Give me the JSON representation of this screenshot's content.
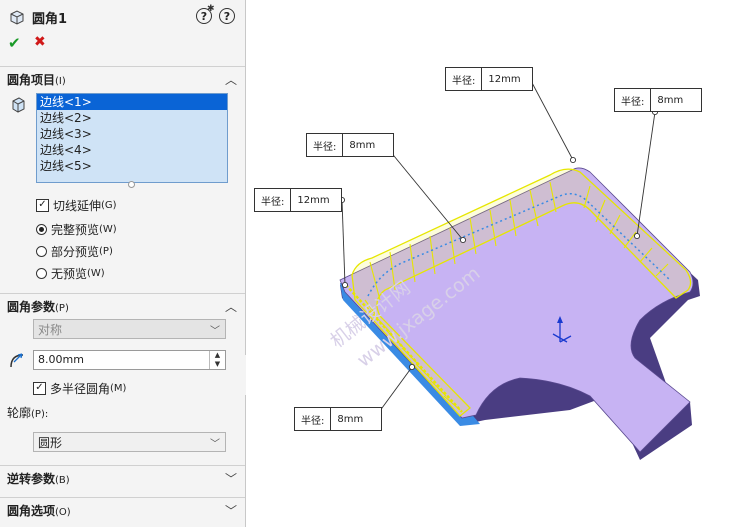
{
  "feature": {
    "title": "圆角1"
  },
  "section_items": {
    "title": "圆角项目",
    "shortcut": "(I)",
    "edges": [
      "边线<1>",
      "边线<2>",
      "边线<3>",
      "边线<4>",
      "边线<5>"
    ],
    "tangent_propagation": {
      "label": "切线延伸",
      "shortcut": "(G)",
      "checked": true
    },
    "preview_options": [
      {
        "label": "完整预览",
        "shortcut": "(W)",
        "selected": true
      },
      {
        "label": "部分预览",
        "shortcut": "(P)",
        "selected": false
      },
      {
        "label": "无预览",
        "shortcut": "(W)",
        "selected": false
      }
    ]
  },
  "section_params": {
    "title": "圆角参数",
    "shortcut": "(P)",
    "method": "对称",
    "radius": "8.00mm",
    "multi_radius": {
      "label": "多半径圆角",
      "shortcut": "(M)",
      "checked": true
    },
    "profile_label": "轮廓",
    "profile_shortcut": "(P):",
    "profile": "圆形"
  },
  "section_reverse": {
    "title": "逆转参数",
    "shortcut": "(B)"
  },
  "section_options": {
    "title": "圆角选项",
    "shortcut": "(O)"
  },
  "callouts": [
    {
      "key": "半径:",
      "value": "12mm"
    },
    {
      "key": "半径:",
      "value": "8mm"
    },
    {
      "key": "半径:",
      "value": "8mm"
    },
    {
      "key": "半径:",
      "value": "12mm"
    },
    {
      "key": "半径:",
      "value": "8mm"
    }
  ],
  "watermark": {
    "line1": "机械设计网",
    "line2": "www.jxage.com"
  },
  "colors": {
    "face": "#c7b3f3",
    "side": "#4a3d82",
    "highlight": "#f2f23b",
    "edge_blue": "#3a8be4"
  }
}
